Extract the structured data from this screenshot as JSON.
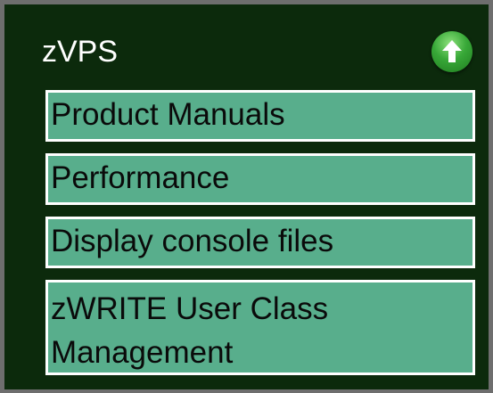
{
  "panel": {
    "title": "zVPS",
    "up_button_icon": "arrow-up-icon"
  },
  "menu": {
    "items": [
      {
        "label": "Product Manuals"
      },
      {
        "label": "Performance"
      },
      {
        "label": "Display console files"
      },
      {
        "label": "zWRITE User Class Management"
      }
    ]
  },
  "colors": {
    "panel_background": "#0c2a0c",
    "item_background": "#58ae8c",
    "item_border": "#ffffff",
    "up_button": "#38a838"
  }
}
